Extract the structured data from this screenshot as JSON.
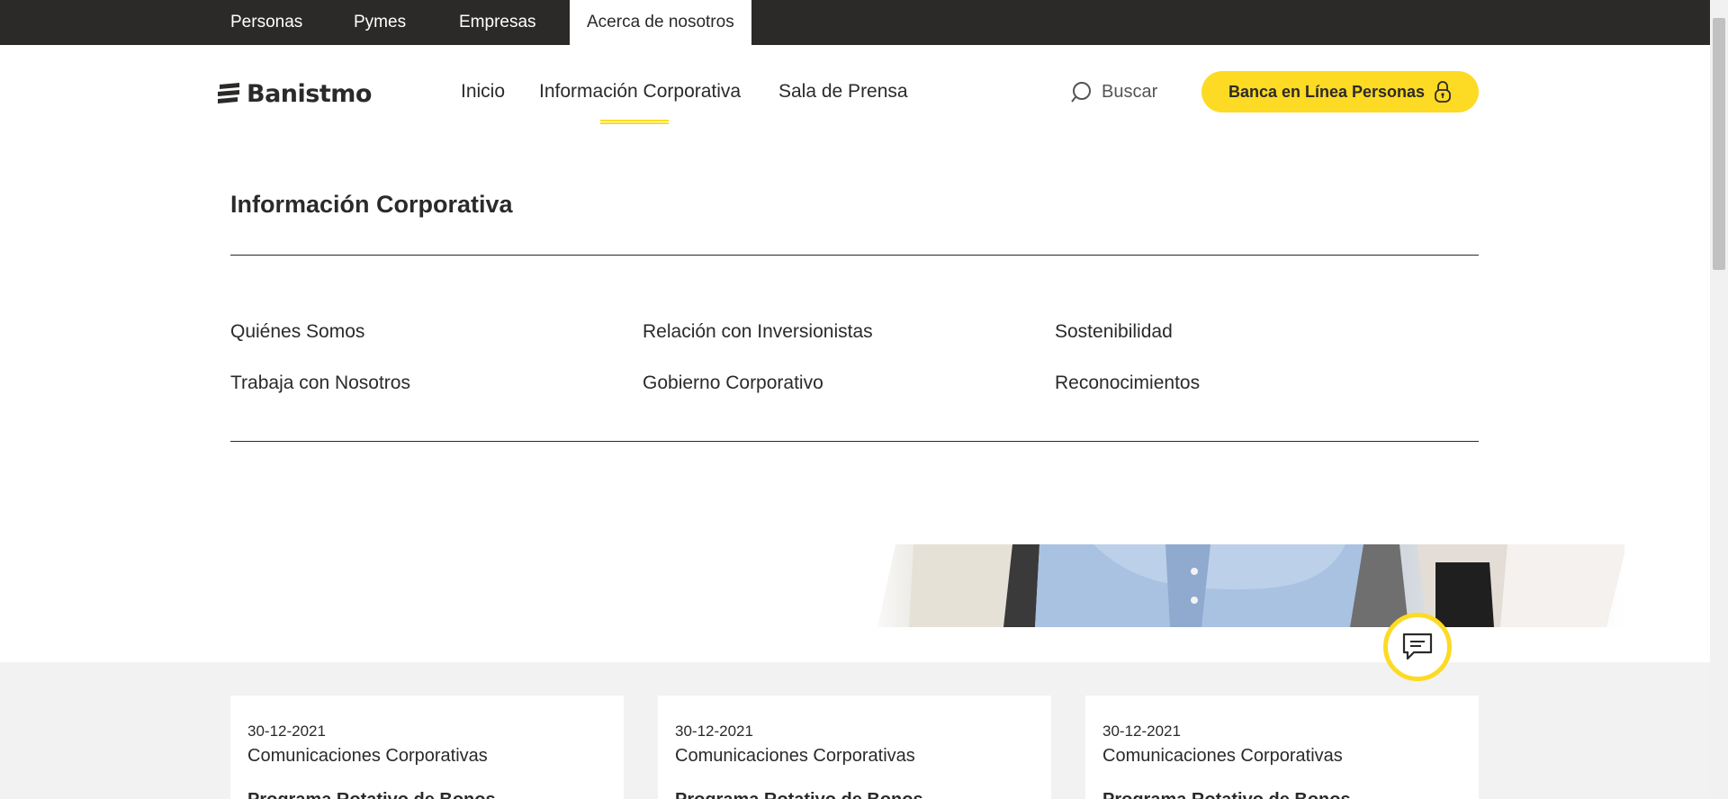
{
  "topbar": {
    "segments": [
      {
        "label": "Personas"
      },
      {
        "label": "Pymes"
      },
      {
        "label": "Empresas"
      },
      {
        "label": "Acerca de nosotros",
        "active": true
      }
    ]
  },
  "header": {
    "logo_text": "Banistmo",
    "nav": [
      {
        "label": "Inicio"
      },
      {
        "label": "Información Corporativa",
        "active": true
      },
      {
        "label": "Sala de Prensa"
      }
    ],
    "search_label": "Buscar",
    "search_icon": "search-icon",
    "cta_label": "Banca en Línea Personas",
    "cta_icon": "lock-icon"
  },
  "section": {
    "title": "Información Corporativa",
    "links": [
      "Quiénes Somos",
      "Relación con Inversionistas",
      "Sostenibilidad",
      "Trabaja con Nosotros",
      "Gobierno Corporativo",
      "Reconocimientos"
    ]
  },
  "news": {
    "cards": [
      {
        "date": "30-12-2021",
        "category": "Comunicaciones Corporativas",
        "title": "Programa Rotativo de Bonos"
      },
      {
        "date": "30-12-2021",
        "category": "Comunicaciones Corporativas",
        "title": "Programa Rotativo de Bonos"
      },
      {
        "date": "30-12-2021",
        "category": "Comunicaciones Corporativas",
        "title": "Programa Rotativo de Bonos"
      }
    ]
  },
  "chat": {
    "icon": "chat-icon"
  },
  "colors": {
    "brand_yellow": "#fdda24",
    "dark": "#2c2a29",
    "news_bg": "#f2f2f2"
  }
}
